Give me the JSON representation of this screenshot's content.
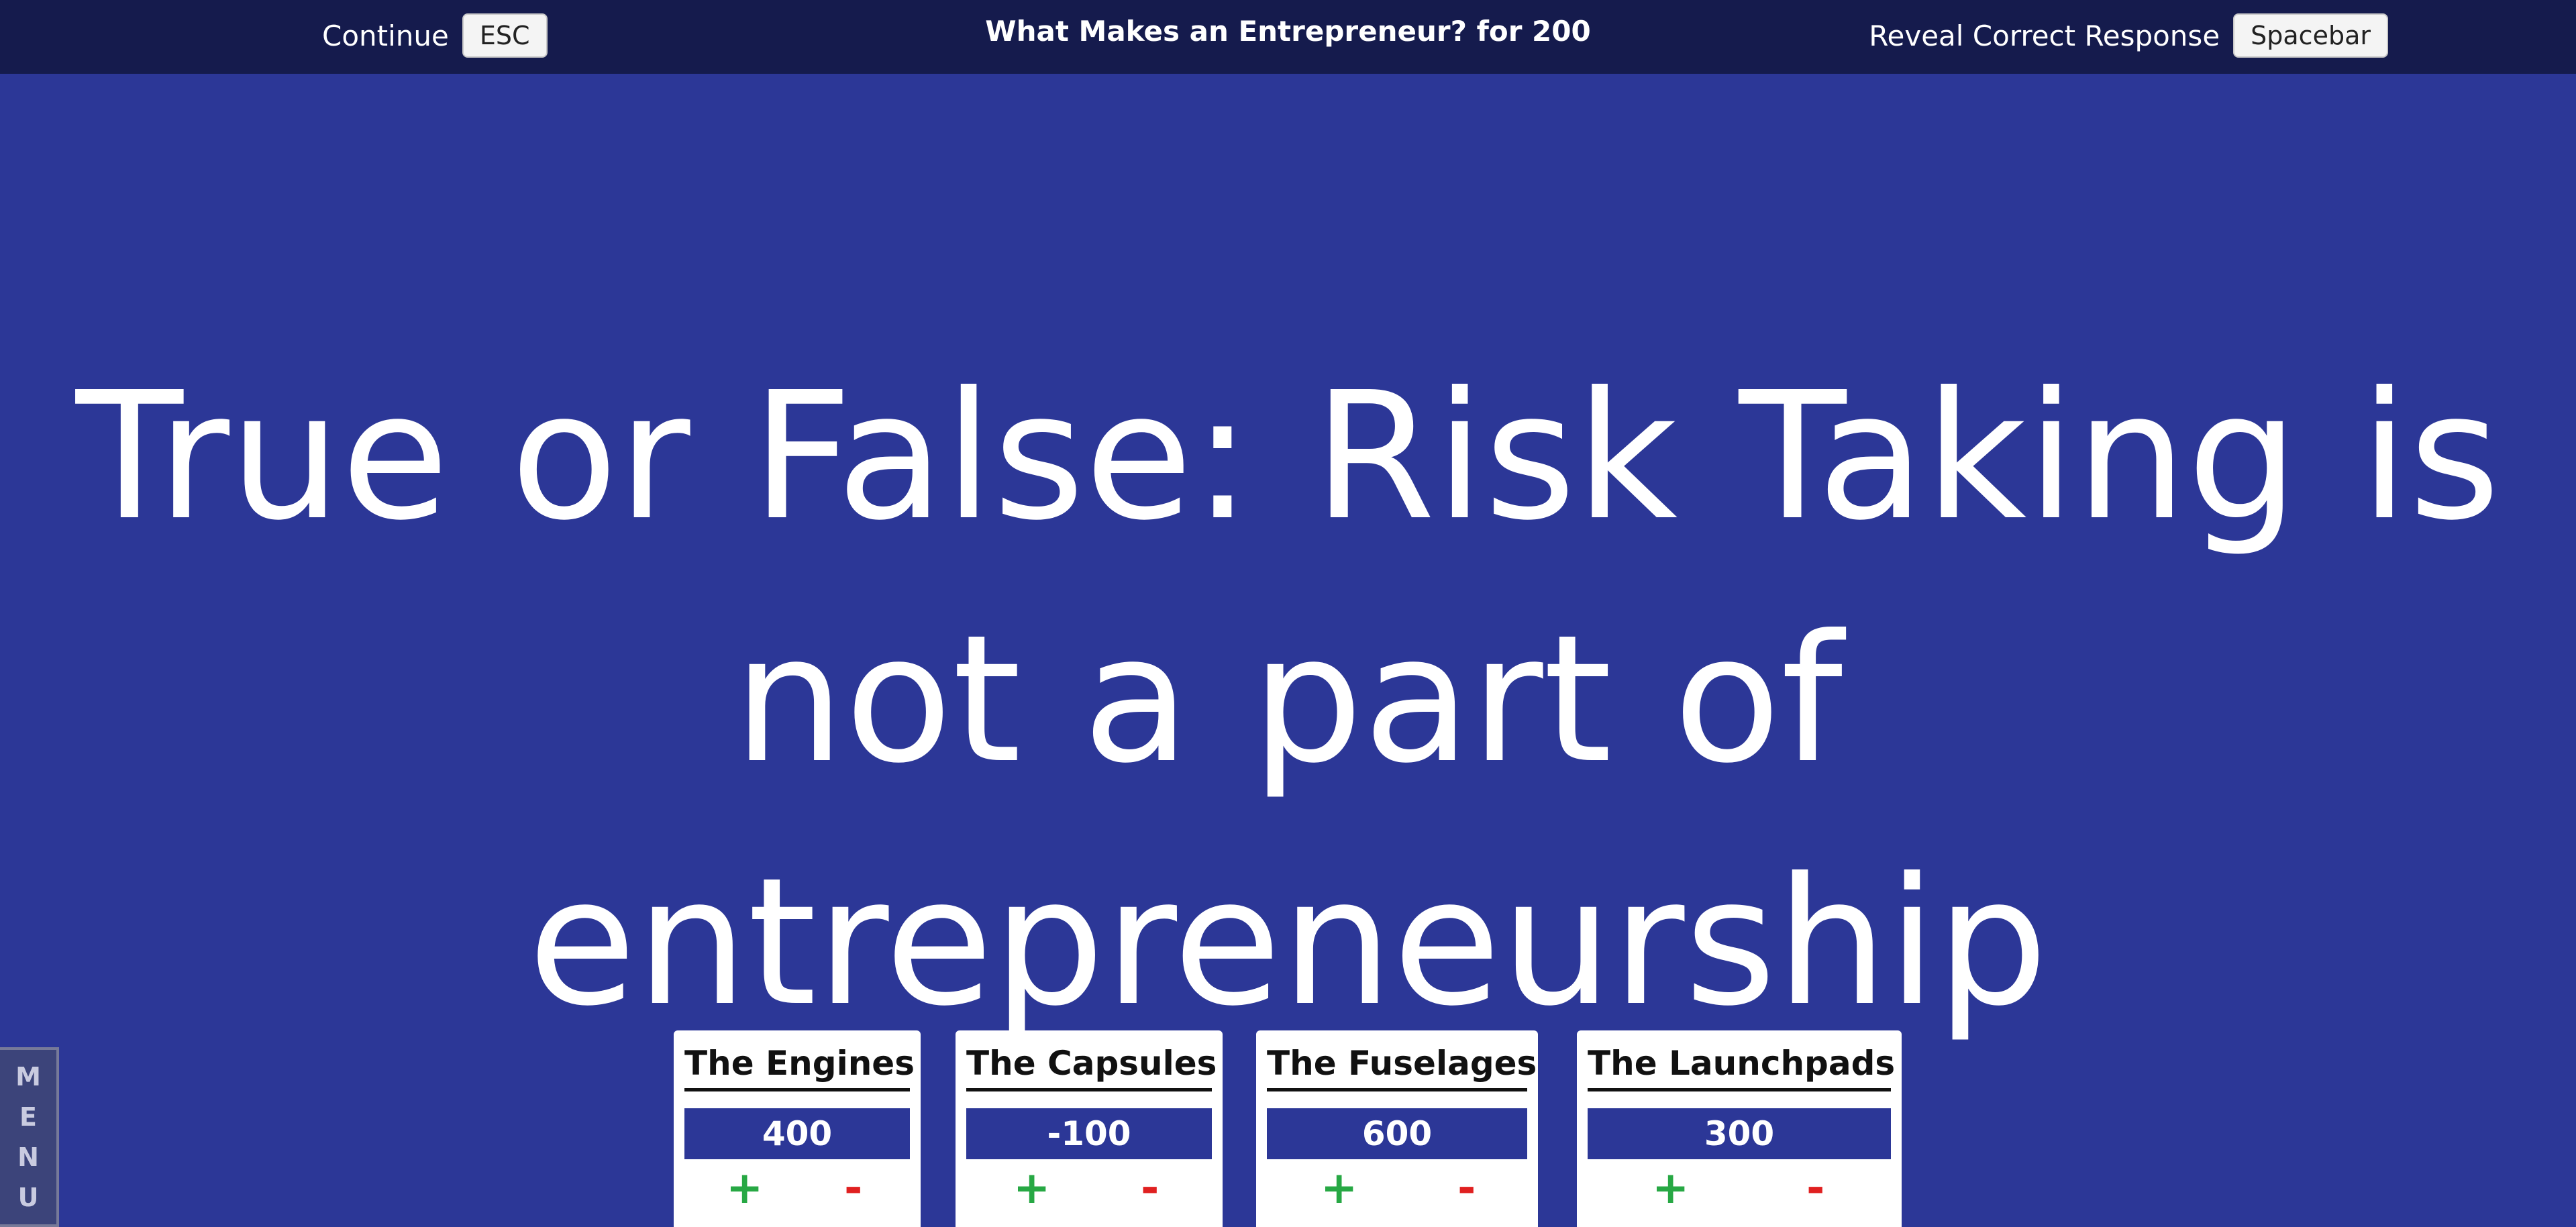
{
  "topbar": {
    "continue_label": "Continue",
    "continue_key": "ESC",
    "title": "What Makes an Entrepreneur? for 200",
    "reveal_label": "Reveal Correct Response",
    "reveal_key": "Spacebar"
  },
  "clue": {
    "line1": "True or False: Risk Taking is",
    "line2": "not a part of entrepreneurship"
  },
  "menu": {
    "letters": [
      "M",
      "E",
      "N",
      "U"
    ]
  },
  "teams": [
    {
      "name": "The Engines",
      "score": "400",
      "plus": "+",
      "minus": "-"
    },
    {
      "name": "The Capsules",
      "score": "-100",
      "plus": "+",
      "minus": "-"
    },
    {
      "name": "The Fuselages",
      "score": "600",
      "plus": "+",
      "minus": "-"
    },
    {
      "name": "The Launchpads",
      "score": "300",
      "plus": "+",
      "minus": "-"
    }
  ],
  "colors": {
    "background": "#2c3797",
    "topbar": "#151b4d",
    "plus": "#27a844",
    "minus": "#e02020"
  }
}
